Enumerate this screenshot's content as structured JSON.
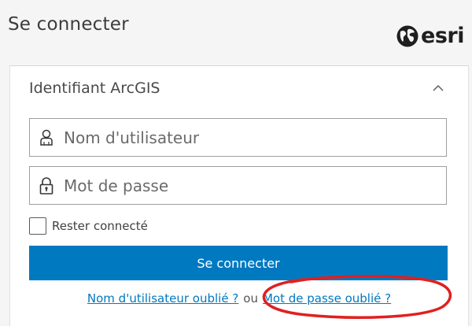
{
  "header": {
    "title": "Se connecter",
    "brand_name": "esri",
    "brand_icon": "globe-icon"
  },
  "form": {
    "section_title": "Identifiant ArcGIS",
    "username": {
      "placeholder": "Nom d'utilisateur",
      "value": "",
      "icon": "user-icon"
    },
    "password": {
      "placeholder": "Mot de passe",
      "value": "",
      "icon": "lock-icon"
    },
    "remember_label": "Rester connecté",
    "remember_checked": false,
    "submit_label": "Se connecter"
  },
  "links": {
    "forgot_username": "Nom d'utilisateur oublié ?",
    "separator": "ou",
    "forgot_password": "Mot de passe oublié ?"
  },
  "colors": {
    "primary": "#0079c1",
    "annotation": "#e02020",
    "background": "#f5f5f5"
  }
}
